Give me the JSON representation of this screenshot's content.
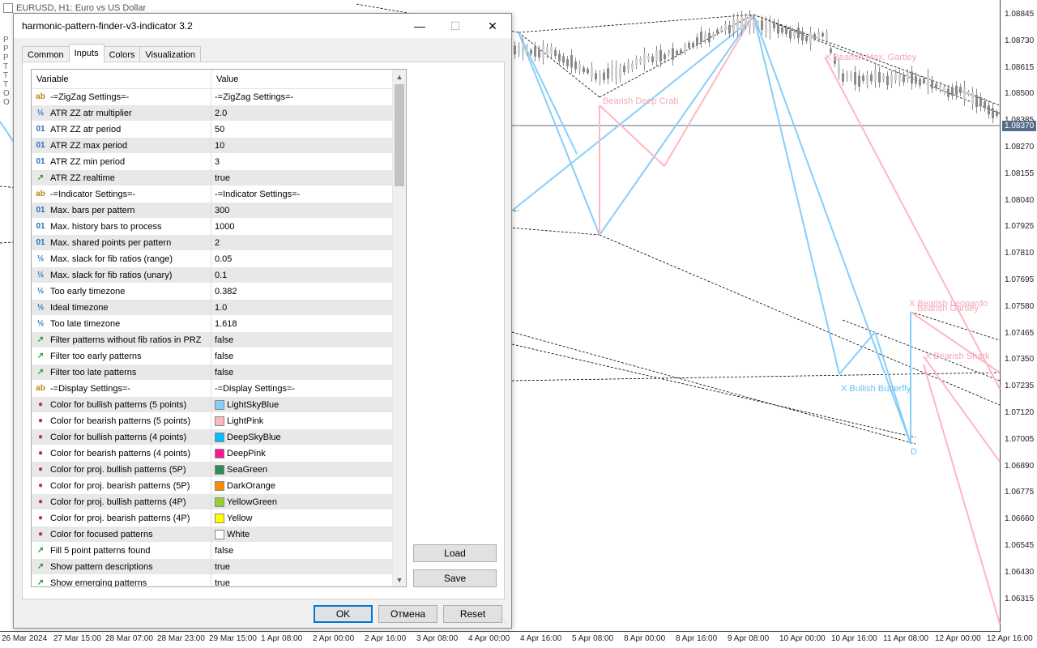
{
  "chart": {
    "window_title": "EURUSD, H1: Euro vs US Dollar",
    "price_axis": [
      "1.08845",
      "1.08730",
      "1.08615",
      "1.08500",
      "1.08385",
      "1.08270",
      "1.08155",
      "1.08040",
      "1.07925",
      "1.07810",
      "1.07695",
      "1.07580",
      "1.07465",
      "1.07350",
      "1.07235",
      "1.07120",
      "1.07005",
      "1.06890",
      "1.06775",
      "1.06660",
      "1.06545",
      "1.06430",
      "1.06315"
    ],
    "current_price": "1.08370",
    "time_axis": [
      "26 Mar 2024",
      "27 Mar 15:00",
      "28 Mar 07:00",
      "28 Mar 23:00",
      "29 Mar 15:00",
      "1 Apr 08:00",
      "2 Apr 00:00",
      "2 Apr 16:00",
      "3 Apr 08:00",
      "4 Apr 00:00",
      "4 Apr 16:00",
      "5 Apr 08:00",
      "8 Apr 00:00",
      "8 Apr 16:00",
      "9 Apr 08:00",
      "10 Apr 00:00",
      "10 Apr 16:00",
      "11 Apr 08:00",
      "12 Apr 00:00",
      "12 Apr 16:00"
    ],
    "pattern_labels": [
      {
        "text": "X Bearish Max. Gartley",
        "color": "#f4a6b7"
      },
      {
        "text": "Bearish Deep Crab",
        "color": "#f4a6b7"
      },
      {
        "text": "X Bearish Leonardo",
        "color": "#f4a6b7"
      },
      {
        "text": "Bearish Gartley",
        "color": "#f4a6b7"
      },
      {
        "text": "X Bearish Shark",
        "color": "#f4a6b7"
      },
      {
        "text": "X Bullish Butterfly",
        "color": "#6ec1f2"
      },
      {
        "text": "D",
        "color": "#6ec1f2"
      }
    ],
    "colors": {
      "bullish": "#87cefa",
      "bearish": "#ffb6c1",
      "grid": "#000000"
    }
  },
  "dialog": {
    "title": "harmonic-pattern-finder-v3-indicator 3.2",
    "tabs": [
      "Common",
      "Inputs",
      "Colors",
      "Visualization"
    ],
    "active_tab": "Inputs",
    "columns": {
      "variable": "Variable",
      "value": "Value"
    },
    "rows": [
      {
        "icon": "ab",
        "name": "-=ZigZag Settings=-",
        "value": "-=ZigZag Settings=-"
      },
      {
        "icon": "½",
        "name": "ATR ZZ atr multiplier",
        "value": "2.0"
      },
      {
        "icon": "01",
        "name": "ATR ZZ atr period",
        "value": "50"
      },
      {
        "icon": "01",
        "name": "ATR ZZ max period",
        "value": "10"
      },
      {
        "icon": "01",
        "name": "ATR ZZ min period",
        "value": "3"
      },
      {
        "icon": "bool",
        "name": "ATR ZZ realtime",
        "value": "true"
      },
      {
        "icon": "ab",
        "name": "-=Indicator Settings=-",
        "value": "-=Indicator Settings=-"
      },
      {
        "icon": "01",
        "name": "Max. bars per pattern",
        "value": "300"
      },
      {
        "icon": "01",
        "name": "Max. history bars to process",
        "value": "1000"
      },
      {
        "icon": "01",
        "name": "Max. shared points per pattern",
        "value": "2"
      },
      {
        "icon": "½",
        "name": "Max. slack for fib ratios (range)",
        "value": "0.05"
      },
      {
        "icon": "½",
        "name": "Max. slack for fib ratios (unary)",
        "value": "0.1"
      },
      {
        "icon": "½",
        "name": "Too early timezone",
        "value": "0.382"
      },
      {
        "icon": "½",
        "name": "Ideal timezone",
        "value": "1.0"
      },
      {
        "icon": "½",
        "name": "Too late timezone",
        "value": "1.618"
      },
      {
        "icon": "bool",
        "name": "Filter patterns without fib ratios in PRZ",
        "value": "false"
      },
      {
        "icon": "bool",
        "name": "Filter too early patterns",
        "value": "false"
      },
      {
        "icon": "bool",
        "name": "Filter too late patterns",
        "value": "false"
      },
      {
        "icon": "ab",
        "name": "-=Display Settings=-",
        "value": "-=Display Settings=-"
      },
      {
        "icon": "color",
        "name": "Color for bullish patterns (5 points)",
        "value": "LightSkyBlue",
        "swatch": "#87cefa"
      },
      {
        "icon": "color",
        "name": "Color for bearish patterns (5 points)",
        "value": "LightPink",
        "swatch": "#ffb6c1"
      },
      {
        "icon": "color",
        "name": "Color for bullish patterns (4 points)",
        "value": "DeepSkyBlue",
        "swatch": "#00bfff"
      },
      {
        "icon": "color",
        "name": "Color for bearish patterns (4 points)",
        "value": "DeepPink",
        "swatch": "#ff1493"
      },
      {
        "icon": "color",
        "name": "Color for proj. bullish patterns (5P)",
        "value": "SeaGreen",
        "swatch": "#2e8b57"
      },
      {
        "icon": "color",
        "name": "Color for proj. bearish patterns (5P)",
        "value": "DarkOrange",
        "swatch": "#ff8c00"
      },
      {
        "icon": "color",
        "name": "Color for proj. bullish patterns (4P)",
        "value": "YellowGreen",
        "swatch": "#9acd32"
      },
      {
        "icon": "color",
        "name": "Color for proj. bearish patterns (4P)",
        "value": "Yellow",
        "swatch": "#ffff00"
      },
      {
        "icon": "color",
        "name": "Color for focused patterns",
        "value": "White",
        "swatch": "#ffffff"
      },
      {
        "icon": "bool",
        "name": "Fill 5 point patterns found",
        "value": "false"
      },
      {
        "icon": "bool",
        "name": "Show pattern descriptions",
        "value": "true"
      },
      {
        "icon": "bool",
        "name": "Show emerging patterns",
        "value": "true"
      }
    ],
    "buttons": {
      "load": "Load",
      "save": "Save",
      "ok": "OK",
      "cancel": "Отмена",
      "reset": "Reset"
    }
  }
}
